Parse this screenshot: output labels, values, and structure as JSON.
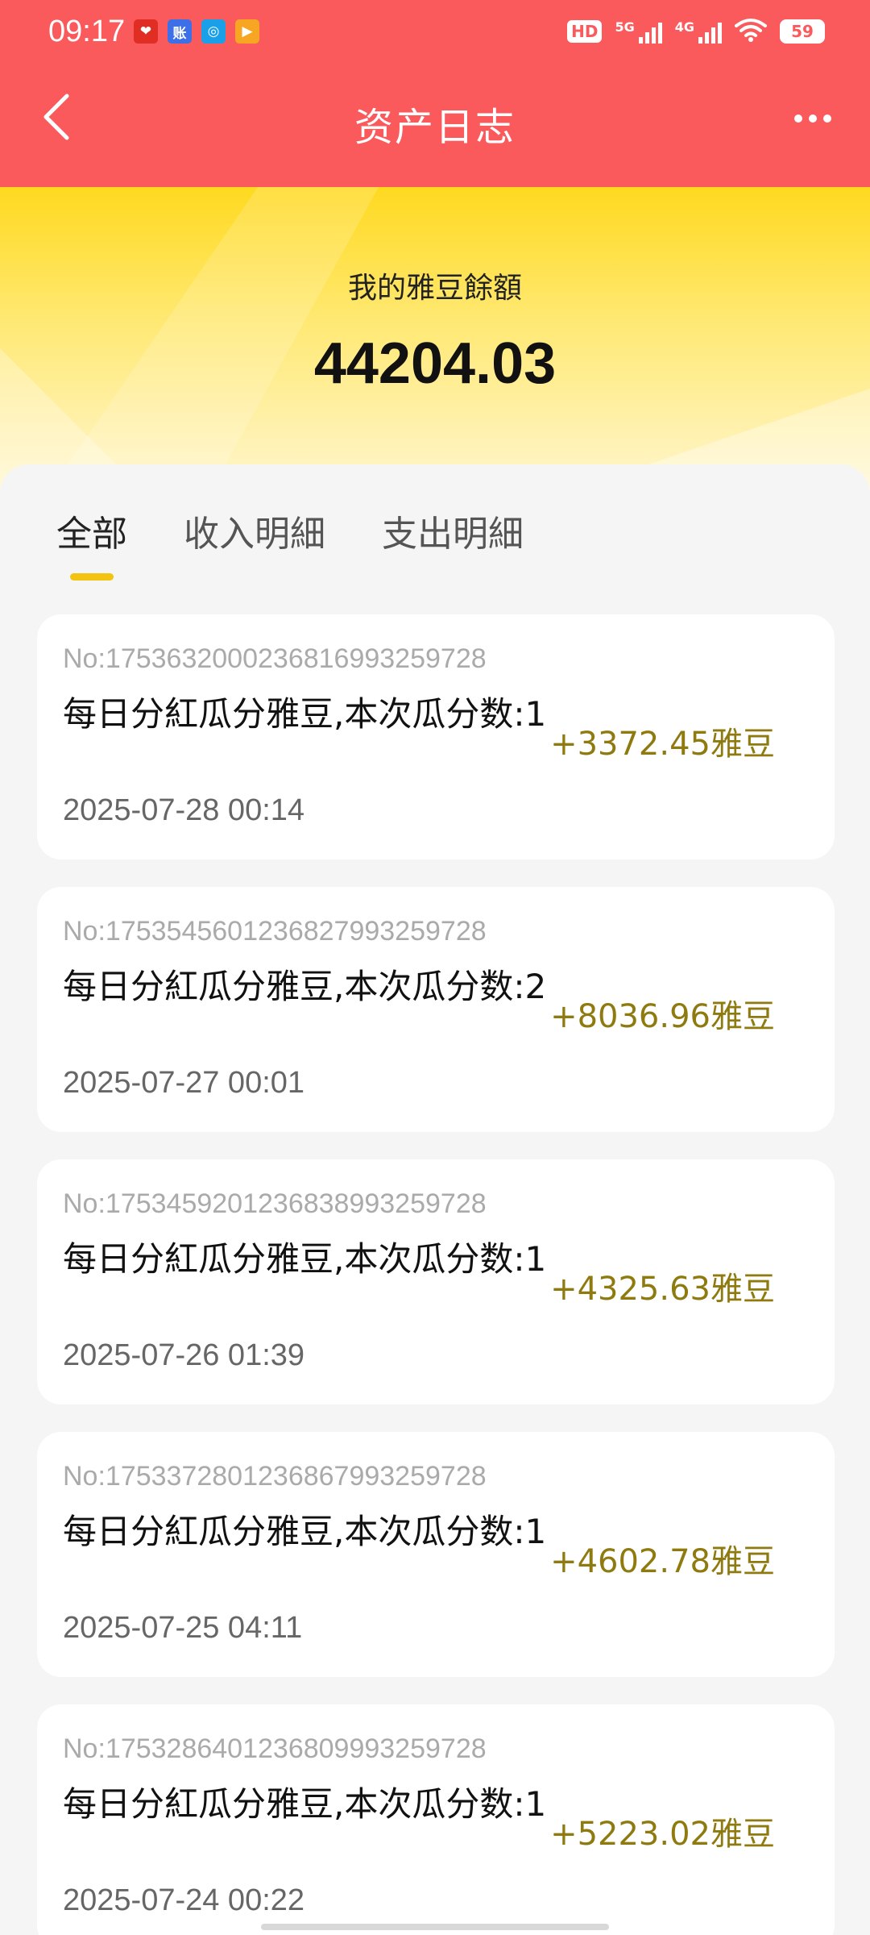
{
  "status_bar": {
    "time": "09:17",
    "apps": [
      {
        "icon": "pinduoduo-app-icon",
        "glyph": "❤",
        "color": "#e02e24"
      },
      {
        "icon": "ledger-app-icon",
        "glyph": "账",
        "color": "#3d6fe8"
      },
      {
        "icon": "china-mobile-app-icon",
        "glyph": "◎",
        "color": "#1aa0e8"
      },
      {
        "icon": "video-app-icon",
        "glyph": "▶",
        "color": "#f6a623"
      }
    ],
    "hd": "HD",
    "network_5g": "5G",
    "network_4g": "4G",
    "battery": "59"
  },
  "header": {
    "title": "资产日志"
  },
  "balance": {
    "label": "我的雅豆餘額",
    "value": "44204.03"
  },
  "tabs": [
    {
      "label": "全部",
      "active": true
    },
    {
      "label": "收入明細",
      "active": false
    },
    {
      "label": "支出明細",
      "active": false
    }
  ],
  "records": [
    {
      "no": "No:1753632000236816993259728",
      "desc": "每日分紅瓜分雅豆,本次瓜分数:1",
      "date": "2025-07-28 00:14",
      "amount": "+3372.45雅豆"
    },
    {
      "no": "No:1753545601236827993259728",
      "desc": "每日分紅瓜分雅豆,本次瓜分数:2",
      "date": "2025-07-27 00:01",
      "amount": "+8036.96雅豆"
    },
    {
      "no": "No:1753459201236838993259728",
      "desc": "每日分紅瓜分雅豆,本次瓜分数:1",
      "date": "2025-07-26 01:39",
      "amount": "+4325.63雅豆"
    },
    {
      "no": "No:1753372801236867993259728",
      "desc": "每日分紅瓜分雅豆,本次瓜分数:1",
      "date": "2025-07-25 04:11",
      "amount": "+4602.78雅豆"
    },
    {
      "no": "No:1753286401236809993259728",
      "desc": "每日分紅瓜分雅豆,本次瓜分数:1",
      "date": "2025-07-24 00:22",
      "amount": "+5223.02雅豆"
    }
  ],
  "colors": {
    "header_bg": "#fb5a5c",
    "accent_yellow": "#f2c311",
    "amount_text": "#8f7a10"
  }
}
